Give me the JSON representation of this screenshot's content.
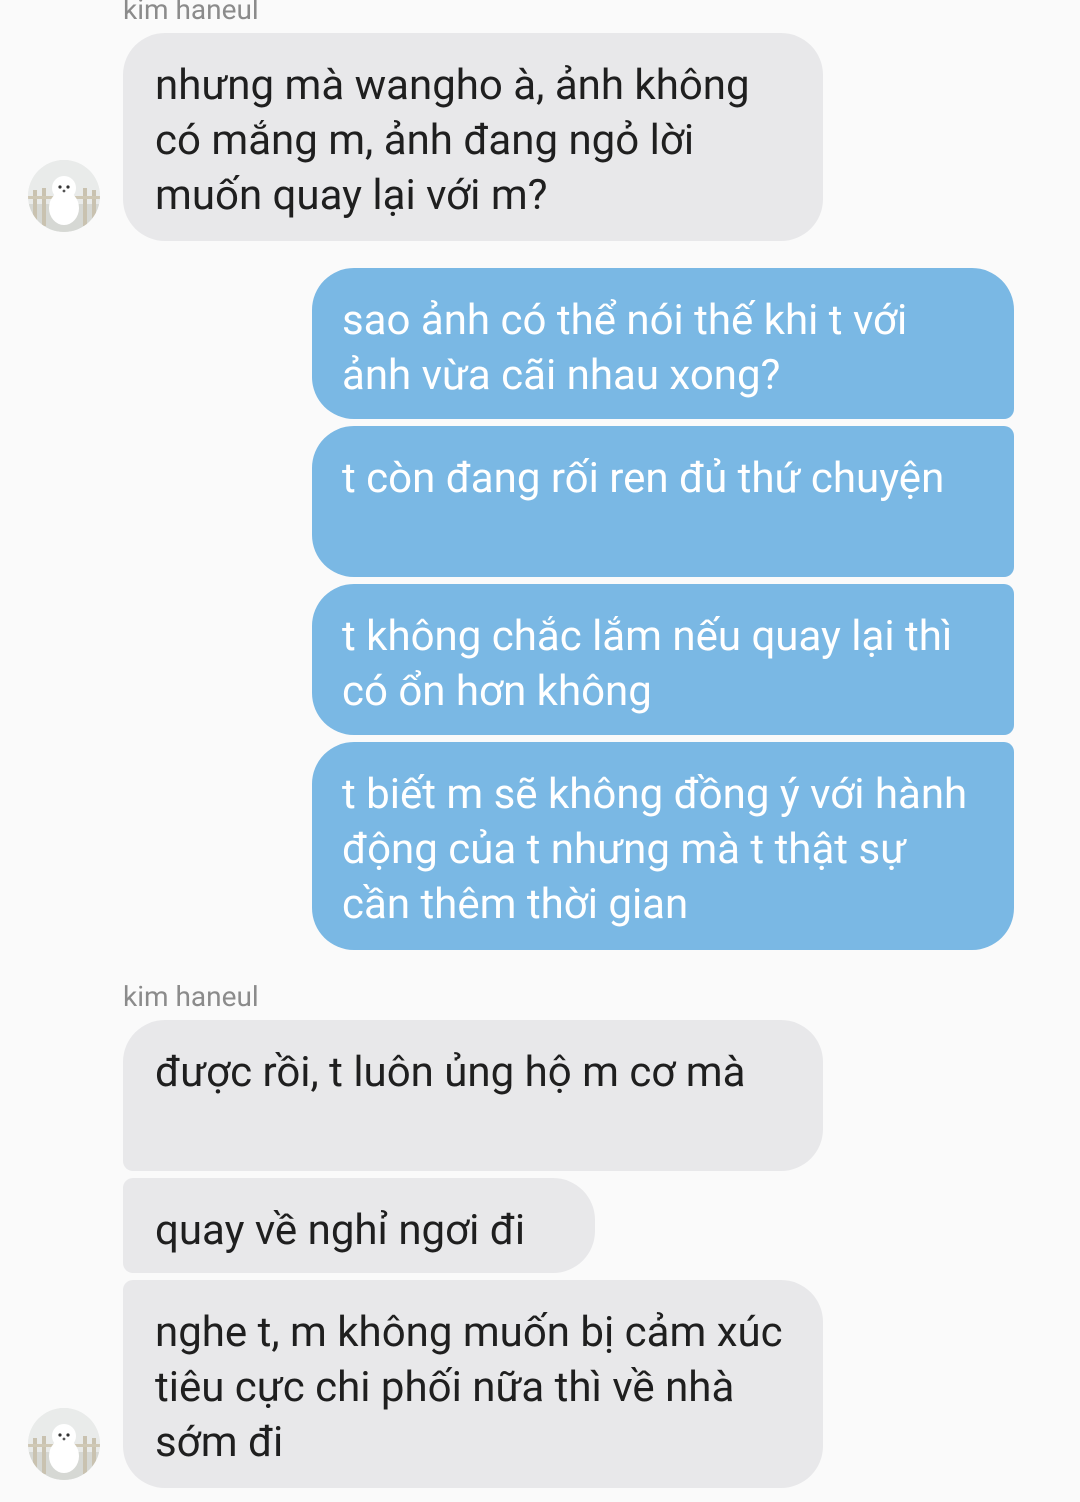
{
  "accent_colors": {
    "incoming_bubble": "#e8e8ea",
    "outgoing_bubble": "#7ab8e4",
    "background": "#fafafa",
    "sender_name": "#8b8b8b"
  },
  "conversation": {
    "groups": [
      {
        "sender": "kim haneul",
        "messages": [
          "nhưng mà wangho à, ảnh không có mắng m, ảnh đang ngỏ lời muốn quay lại với m?"
        ]
      },
      {
        "sender": "",
        "messages": [
          "sao ảnh có thể nói thế khi t với ảnh vừa cãi nhau xong?",
          "t còn đang rối ren đủ thứ chuyện",
          "t không chắc lắm nếu quay lại thì có ổn hơn không",
          "t biết m sẽ không đồng ý với hành động của t nhưng mà t thật sự cần thêm thời gian"
        ]
      },
      {
        "sender": "kim haneul",
        "messages": [
          "được rồi, t luôn ủng hộ m cơ mà",
          "quay về nghỉ ngơi đi",
          "nghe t, m không muốn bị cảm xúc tiêu cực chi phối nữa thì về nhà sớm đi"
        ]
      }
    ]
  },
  "icons": {
    "avatar": "avatar-dog-photo"
  }
}
